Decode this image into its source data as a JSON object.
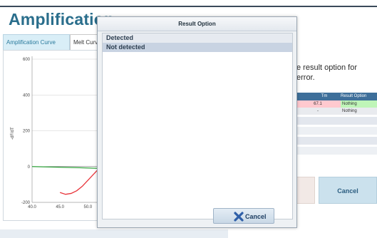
{
  "page": {
    "title": "Amplification"
  },
  "tabs": [
    {
      "label": "Amplification Curve"
    },
    {
      "label": "Melt Curve"
    }
  ],
  "chart": {
    "y_label": "-dF/dT",
    "y_ticks": [
      "600",
      "400",
      "200",
      "0",
      "-200"
    ],
    "x_ticks": [
      "40.0",
      "45.0",
      "50.0"
    ]
  },
  "chart_data": {
    "type": "line",
    "title": "",
    "xlabel": "",
    "ylabel": "-dF/dT",
    "xlim": [
      40,
      52
    ],
    "ylim": [
      -200,
      600
    ],
    "grid": true,
    "series": [
      {
        "color": "#e8343a",
        "x": [
          45.0,
          46.0,
          47.0,
          48.0,
          49.0,
          50.5,
          52.0
        ],
        "y": [
          -145,
          -155,
          -150,
          -135,
          -110,
          -60,
          -10
        ]
      },
      {
        "color": "#2fa13a",
        "x": [
          40.0,
          44.0,
          48.0,
          52.0
        ],
        "y": [
          0,
          -3,
          -6,
          -10
        ]
      }
    ]
  },
  "message": {
    "text": "e result option for\nerror."
  },
  "result_table": {
    "headers": [
      "Tm",
      "Result Option"
    ],
    "rows": [
      {
        "tm": "67.1",
        "result": "Nothing",
        "color": "#ffc9cf",
        "result_color": "#bff5b8"
      },
      {
        "tm": "-",
        "result": "Nothing",
        "color": "#e9ebef",
        "result_color": "#e9ebef"
      }
    ]
  },
  "background_cancel": {
    "label": "Cancel"
  },
  "dialog": {
    "title": "Result Option",
    "options": [
      {
        "label": "Detected",
        "selected": false
      },
      {
        "label": "Not detected",
        "selected": true
      }
    ],
    "cancel_label": "Cancel"
  },
  "colors": {
    "title_blue": "#2a6e8c",
    "table_header": "#3e6f9a",
    "cancel_icon": "#2f5fa8"
  }
}
